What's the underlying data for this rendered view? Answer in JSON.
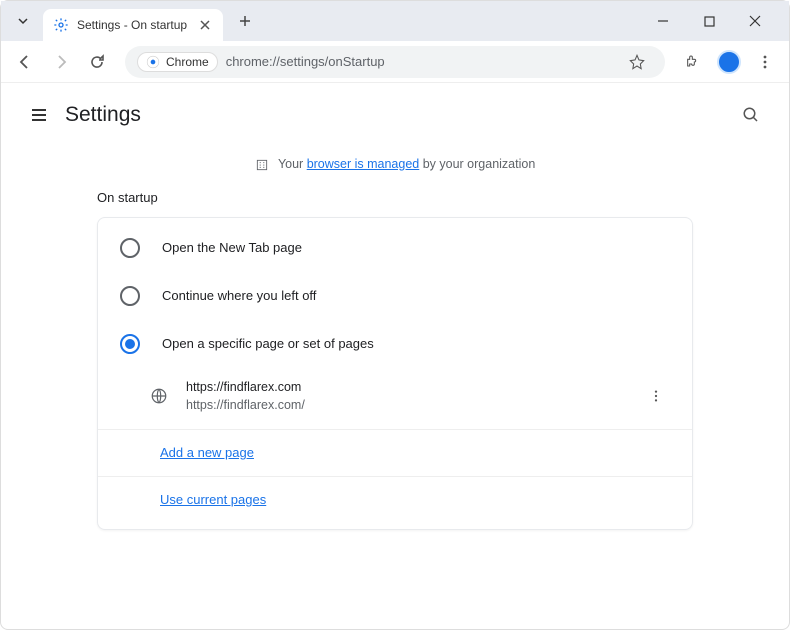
{
  "window": {
    "tab_title": "Settings - On startup"
  },
  "toolbar": {
    "omnibox_chip": "Chrome",
    "url": "chrome://settings/onStartup"
  },
  "header": {
    "title": "Settings"
  },
  "managed": {
    "prefix": "Your ",
    "link": "browser is managed",
    "suffix": " by your organization"
  },
  "section": {
    "title": "On startup",
    "options": [
      {
        "label": "Open the New Tab page"
      },
      {
        "label": "Continue where you left off"
      },
      {
        "label": "Open a specific page or set of pages"
      }
    ],
    "page_entry": {
      "title": "https://findflarex.com",
      "url": "https://findflarex.com/"
    },
    "add_link": "Add a new page",
    "use_current": "Use current pages"
  }
}
